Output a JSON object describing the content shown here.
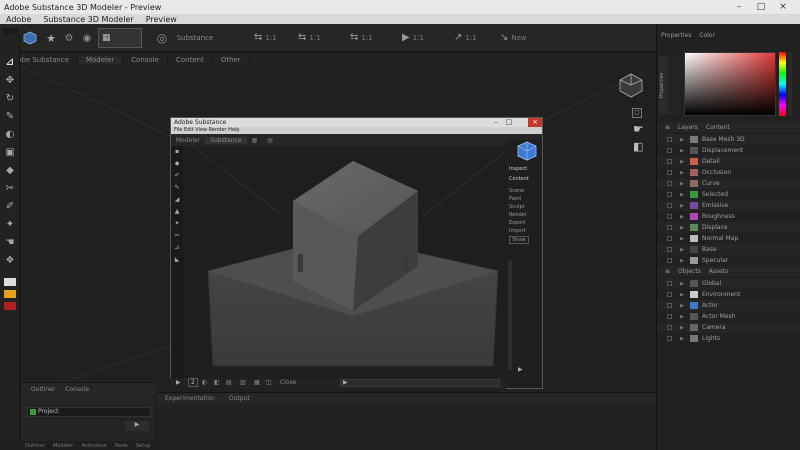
{
  "window": {
    "title": "Adobe Substance 3D Modeler - Preview",
    "controls": {
      "minimize": "–",
      "maximize": "□",
      "close": "×"
    }
  },
  "menubar": {
    "items": [
      "Adobe",
      "Substance 3D Modeler",
      "Preview"
    ]
  },
  "toolbar": {
    "left_label": "Substance",
    "buttons": [
      {
        "glyph": "⇆",
        "label": "1:1"
      },
      {
        "glyph": "⇆",
        "label": "1:1"
      },
      {
        "glyph": "⇆",
        "label": "1:1"
      },
      {
        "glyph": "▶",
        "label": "1:1"
      },
      {
        "glyph": "↗",
        "label": "1:1"
      },
      {
        "glyph": "↘",
        "label": "New"
      }
    ]
  },
  "tabs": [
    "Adobe Substance",
    "Modeler",
    "Console",
    "Content",
    "Other"
  ],
  "dialog": {
    "title": "Adobe Substance",
    "menu": "File Edit View Render Help",
    "tabs": [
      "Modeler",
      "Substance"
    ],
    "right_items": [
      "Inspect",
      "Content",
      "Scene",
      "Paint",
      "Sculpt",
      "Render",
      "Export",
      "Import",
      "Show"
    ],
    "status": "Close"
  },
  "bottom_panel": {
    "tabs": [
      "Outliner",
      "Console"
    ],
    "field_value": "Project",
    "tabs2": [
      "Experimentation",
      "Output"
    ]
  },
  "status_bar": [
    "Outliner",
    "Modeler",
    "Animation",
    "Node",
    "Setup"
  ],
  "right_panel": {
    "tabs_top": [
      "Properties",
      "Color"
    ],
    "side_label": "Properties",
    "layers_header": [
      "Layers",
      "Content"
    ],
    "layers": [
      {
        "name": "Base Mesh 3D",
        "color": "#7a7a7a"
      },
      {
        "name": "Displacement",
        "color": "#555555"
      },
      {
        "name": "Detail",
        "color": "#c9604a"
      },
      {
        "name": "Occlusion",
        "color": "#a06060"
      },
      {
        "name": "Curve",
        "color": "#8a6d5e"
      },
      {
        "name": "Selected",
        "color": "#3c9a3c"
      },
      {
        "name": "Emissive",
        "color": "#7a4aa0"
      },
      {
        "name": "Roughness",
        "color": "#b04ab0"
      },
      {
        "name": "Displace",
        "color": "#5a8a5a"
      },
      {
        "name": "Normal Map",
        "color": "#bbbbbb"
      },
      {
        "name": "Base",
        "color": "#444444"
      },
      {
        "name": "Specular",
        "color": "#9a9a9a"
      }
    ],
    "objects_header": [
      "Objects",
      "Assets"
    ],
    "objects": [
      {
        "name": "Global",
        "color": "#555555"
      },
      {
        "name": "Environment",
        "color": "#cccccc"
      },
      {
        "name": "Actor",
        "color": "#3a7ac9"
      },
      {
        "name": "Actor Mesh",
        "color": "#555555"
      },
      {
        "name": "Camera",
        "color": "#666666"
      },
      {
        "name": "Lights",
        "color": "#777777"
      }
    ]
  }
}
